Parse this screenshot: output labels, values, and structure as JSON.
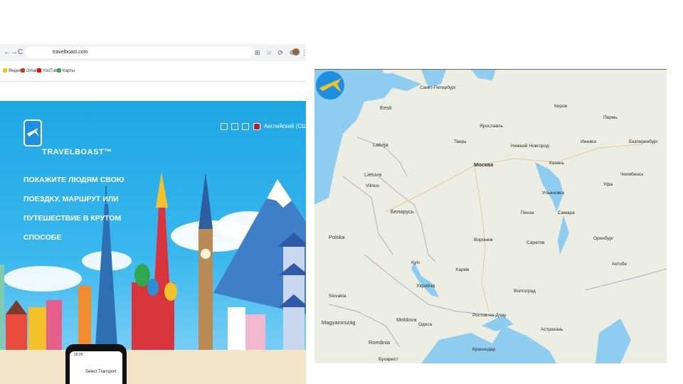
{
  "browser": {
    "nav": {
      "back": "←",
      "forward": "→",
      "reload": "C"
    },
    "url": "travelboast.com",
    "toolbar_icons": "⊞ ☆ ⟳ ⚙ ⋮",
    "bookmarks": [
      {
        "label": "Яндекс",
        "color": "#f5c518"
      },
      {
        "label": "Gmail",
        "color": "#d93025"
      },
      {
        "label": "YouTube",
        "color": "#ff0000"
      },
      {
        "label": "Карты",
        "color": "#34a853"
      }
    ]
  },
  "site": {
    "logo": "TRAVELBOAST™",
    "headline": "ПОКАЖИТЕ ЛЮДЯМ СВОЮ ПОЕЗДКУ, МАРШРУТ ИЛИ ПУТЕШЕСТВИЕ В КРУТОМ СПОСОБЕ",
    "language": "Английский (США)",
    "phone_time": "10:20",
    "phone_button": "Select Transport"
  },
  "map": {
    "colors": {
      "land": "#eceee3",
      "water": "#8ecdf0",
      "border": "#b9a8c4"
    },
    "cities": [
      {
        "label": "Санкт-Петербург",
        "cls": "city"
      },
      {
        "label": "Eesti",
        "cls": "city country"
      },
      {
        "label": "Latvija",
        "cls": "city country"
      },
      {
        "label": "Lietuva",
        "cls": "city country"
      },
      {
        "label": "Vilnius",
        "cls": "city"
      },
      {
        "label": "Беларусь",
        "cls": "city country"
      },
      {
        "label": "Polska",
        "cls": "city country"
      },
      {
        "label": "Україна",
        "cls": "city country"
      },
      {
        "label": "Kyiv",
        "cls": "city"
      },
      {
        "label": "Moldova",
        "cls": "city country"
      },
      {
        "label": "Slovakia",
        "cls": "city"
      },
      {
        "label": "Magyarország",
        "cls": "city country"
      },
      {
        "label": "România",
        "cls": "city country"
      },
      {
        "label": "Бухарест",
        "cls": "city"
      },
      {
        "label": "Москва",
        "cls": "city big"
      },
      {
        "label": "Ярославль",
        "cls": "city"
      },
      {
        "label": "Тверь",
        "cls": "city"
      },
      {
        "label": "Нижний Новгород",
        "cls": "city"
      },
      {
        "label": "Казань",
        "cls": "city"
      },
      {
        "label": "Киров",
        "cls": "city"
      },
      {
        "label": "Пермь",
        "cls": "city"
      },
      {
        "label": "Ижевск",
        "cls": "city"
      },
      {
        "label": "Екатеринбург",
        "cls": "city"
      },
      {
        "label": "Челябинск",
        "cls": "city"
      },
      {
        "label": "Уфа",
        "cls": "city"
      },
      {
        "label": "Ульяновск",
        "cls": "city"
      },
      {
        "label": "Пенза",
        "cls": "city"
      },
      {
        "label": "Самара",
        "cls": "city"
      },
      {
        "label": "Воронеж",
        "cls": "city"
      },
      {
        "label": "Саратов",
        "cls": "city"
      },
      {
        "label": "Оренбург",
        "cls": "city"
      },
      {
        "label": "Актобе",
        "cls": "city"
      },
      {
        "label": "Харків",
        "cls": "city"
      },
      {
        "label": "Волгоград",
        "cls": "city"
      },
      {
        "label": "Ростов-на-Дону",
        "cls": "city"
      },
      {
        "label": "Одеса",
        "cls": "city"
      },
      {
        "label": "Астрахань",
        "cls": "city"
      },
      {
        "label": "Краснодар",
        "cls": "city"
      }
    ]
  }
}
